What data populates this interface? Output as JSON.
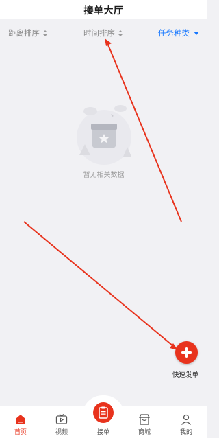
{
  "header": {
    "title": "接单大厅"
  },
  "filters": {
    "distance": "距离排序",
    "time": "时间排序",
    "task_type": "任务种类"
  },
  "empty_state": {
    "text": "暂无相关数据"
  },
  "fab": {
    "label": "快速发单"
  },
  "tabbar": {
    "items": [
      {
        "label": "首页",
        "icon": "home-icon",
        "active": true
      },
      {
        "label": "视频",
        "icon": "tv-icon",
        "active": false
      },
      {
        "label": "接单",
        "icon": "clipboard-icon",
        "active": false
      },
      {
        "label": "商城",
        "icon": "shop-icon",
        "active": false
      },
      {
        "label": "我的",
        "icon": "user-icon",
        "active": false
      }
    ]
  },
  "colors": {
    "accent": "#e8331d",
    "link": "#1677ff",
    "background": "#f1f1f4"
  }
}
